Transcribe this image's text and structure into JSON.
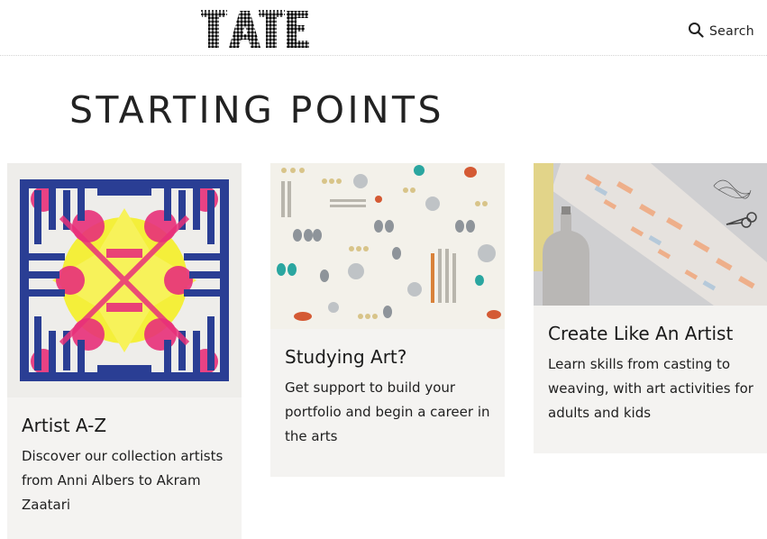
{
  "header": {
    "logo_text": "TATE",
    "search_label": "Search"
  },
  "page_title": "STARTING POINTS",
  "cards": [
    {
      "title": "Artist A-Z",
      "description": "Discover our collection artists from Anni Albers to Akram Zaatari"
    },
    {
      "title": "Studying Art?",
      "description": "Get support to build your portfolio and begin a career in the arts"
    },
    {
      "title": "Create Like An Artist",
      "description": "Learn skills from casting to weaving, with art activities for adults and kids"
    }
  ],
  "colors": {
    "card_background": "#f4f3f1",
    "text": "#1a1a1a",
    "artwork_blue": "#2a3e94",
    "artwork_pink": "#e8307a",
    "artwork_yellow": "#f4ef3a"
  }
}
